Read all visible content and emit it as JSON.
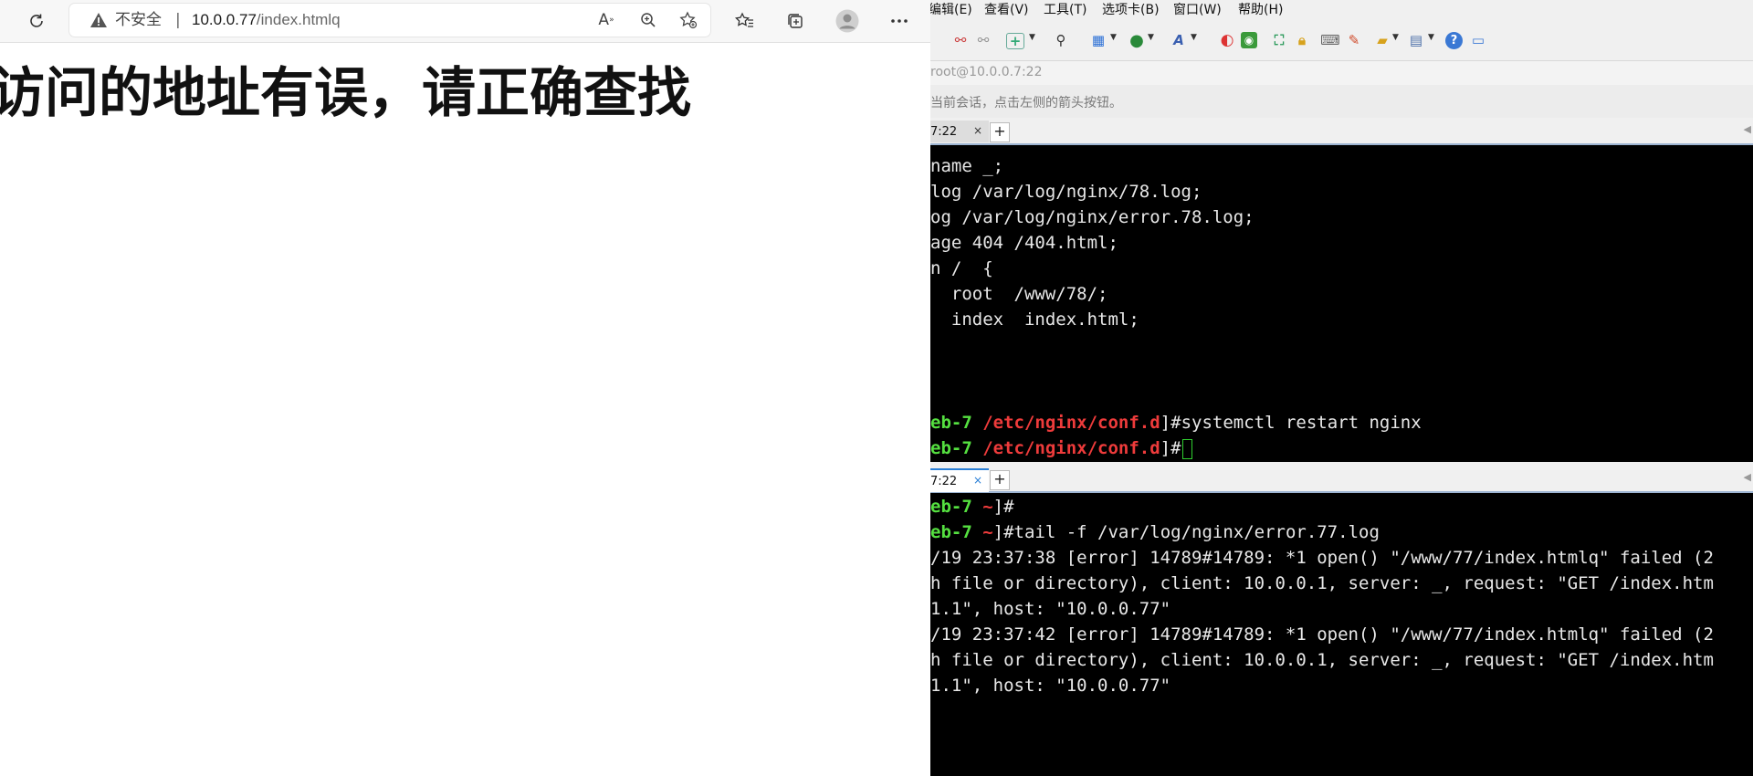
{
  "browser": {
    "security_label": "不安全",
    "separator": "|",
    "url_host": "10.0.0.77",
    "url_path": "/index.htmlq",
    "page_heading": "访问的地址有误，请正确查找",
    "icons": [
      "refresh-icon",
      "warning-icon",
      "read-aloud-icon",
      "zoom-icon",
      "add-favorite-icon",
      "favorites-icon",
      "collections-icon",
      "profile-icon",
      "more-icon"
    ]
  },
  "xshell": {
    "menu": [
      "编辑(E)",
      "查看(V)",
      "工具(T)",
      "选项卡(B)",
      "窗口(W)",
      "帮助(H)"
    ],
    "address": "root@10.0.0.7:22",
    "hint": "当前会话，点击左侧的箭头按钮。",
    "tab1_label": "7:22",
    "tab2_label": "7:22",
    "tab_add": "+",
    "tab_close": "×",
    "pane1_lines": [
      "name _;",
      "log /var/log/nginx/78.log;",
      "og /var/log/nginx/error.78.log;",
      "age 404 /404.html;",
      "n /  {",
      "  root  /www/78/;",
      "  index  index.html;"
    ],
    "pane1_prompt_host": "eb-7 ",
    "pane1_prompt_dir": "/etc/nginx/conf.d",
    "pane1_prompt_close": "]#",
    "pane1_cmd": "systemctl restart nginx",
    "pane2_prompt_host": "eb-7 ",
    "pane2_prompt_dir": "~",
    "pane2_prompt_close": "]#",
    "pane2_cmd": "tail -f /var/log/nginx/error.77.log",
    "pane2_output": [
      "/19 23:37:38 [error] 14789#14789: *1 open() \"/www/77/index.htmlq\" failed (2",
      "h file or directory), client: 10.0.0.1, server: _, request: \"GET /index.htm",
      "1.1\", host: \"10.0.0.77\"",
      "/19 23:37:42 [error] 14789#14789: *1 open() \"/www/77/index.htmlq\" failed (2",
      "h file or directory), client: 10.0.0.1, server: _, request: \"GET /index.htm",
      "1.1\", host: \"10.0.0.77\""
    ]
  }
}
